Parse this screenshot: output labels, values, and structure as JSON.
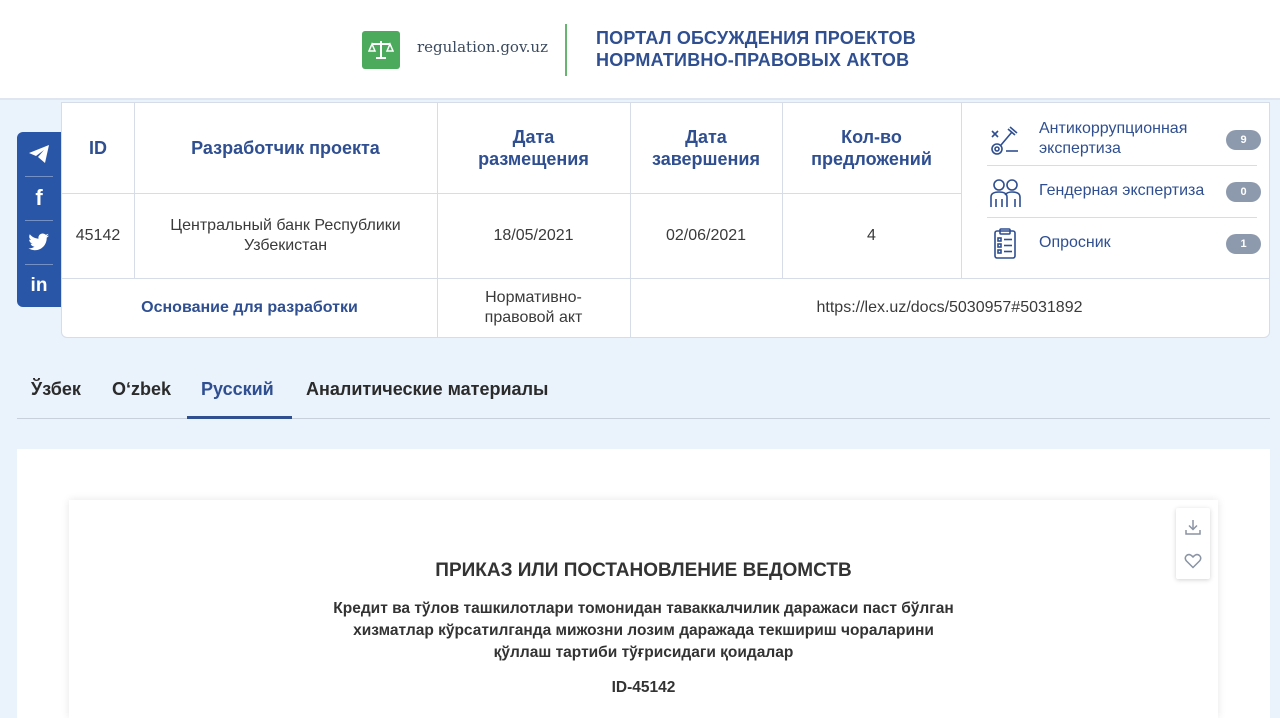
{
  "header": {
    "logo_text": "regulation.gov.uz",
    "title_line1": "ПОРТАЛ ОБСУЖДЕНИЯ ПРОЕКТОВ",
    "title_line2": "НОРМАТИВНО-ПРАВОВЫХ АКТОВ",
    "logo_color": "#4caa5c"
  },
  "social": {
    "icons": [
      "telegram-icon",
      "facebook-icon",
      "twitter-icon",
      "linkedin-icon"
    ],
    "facebook_glyph": "f",
    "linkedin_glyph": "in",
    "color": "#2a56a8"
  },
  "project": {
    "headers": {
      "id": "ID",
      "developer": "Разработчик проекта",
      "posted_line1": "Дата",
      "posted_line2": "размещения",
      "end_line1": "Дата",
      "end_line2": "завершения",
      "count_line1": "Кол-во",
      "count_line2": "предложений"
    },
    "values": {
      "id": "45142",
      "developer_line1": "Центральный банк Республики",
      "developer_line2": "Узбекистан",
      "posted": "18/05/2021",
      "end": "02/06/2021",
      "count": "4"
    },
    "basis_label": "Основание для разработки",
    "basis_type_line1": "Нормативно-",
    "basis_type_line2": "правовой акт",
    "basis_url": "https://lex.uz/docs/5030957#5031892"
  },
  "expertise": [
    {
      "label_line1": "Антикоррупционная",
      "label_line2": "экспертиза",
      "count": "9",
      "icon": "anticorruption-icon"
    },
    {
      "label_line1": "Гендерная экспертиза",
      "count": "0",
      "icon": "gender-icon"
    },
    {
      "label_line1": "Опросник",
      "count": "1",
      "icon": "questionnaire-icon"
    }
  ],
  "tabs": [
    {
      "label": "Ўзбек",
      "active": false
    },
    {
      "label": "Oʻzbek",
      "active": false
    },
    {
      "label": "Русский",
      "active": true
    },
    {
      "label": "Аналитические материалы",
      "active": false
    }
  ],
  "document": {
    "title": "ПРИКАЗ ИЛИ ПОСТАНОВЛЕНИЕ ВЕДОМСТВ",
    "subtitle_line1": "Кредит ва тўлов ташкилотлари томонидан таваккалчилик даражаси паст бўлган",
    "subtitle_line2": "хизматлар кўрсатилганда мижозни лозим даражада текшириш чораларини",
    "subtitle_line3": "қўллаш тартиби тўғрисидаги қоидалар",
    "id_label": "ID-45142",
    "tool_icons": [
      "download-icon",
      "favorite-icon"
    ]
  }
}
